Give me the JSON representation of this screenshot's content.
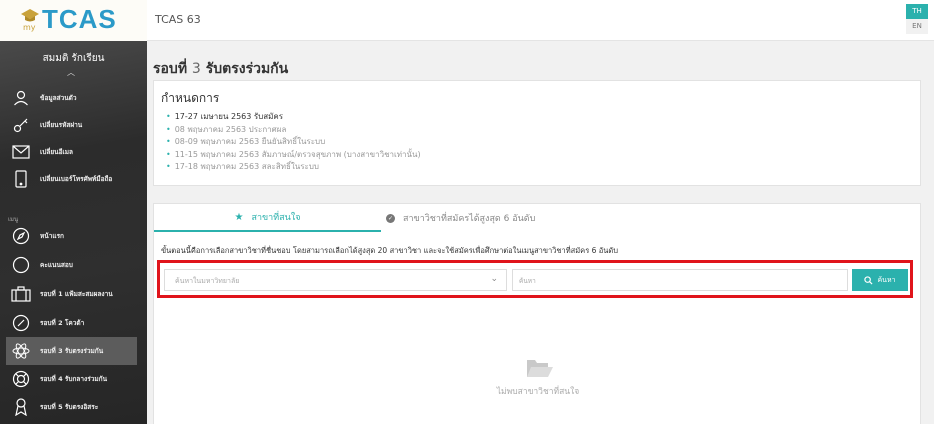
{
  "header": {
    "logo_prefix": "my",
    "logo_text": "TCAS",
    "title": "TCAS 63",
    "lang_th": "TH",
    "lang_en": "EN"
  },
  "sidebar": {
    "user_name": "สมมติ รักเรียน",
    "menu_heading": "เมนู",
    "account_items": [
      {
        "label": "ข้อมูลส่วนตัว",
        "icon": "user-icon"
      },
      {
        "label": "เปลี่ยนรหัสผ่าน",
        "icon": "key-icon"
      },
      {
        "label": "เปลี่ยนอีเมล",
        "icon": "mail-icon"
      },
      {
        "label": "เปลี่ยนเบอร์โทรศัพท์มือถือ",
        "icon": "phone-icon"
      }
    ],
    "menu_items": [
      {
        "label": "หน้าแรก",
        "icon": "compass-icon"
      },
      {
        "label": "คะแนนสอบ",
        "icon": "circle-icon"
      },
      {
        "label": "รอบที่ 1 แฟ้มสะสมผลงาน",
        "icon": "portfolio-icon"
      },
      {
        "label": "รอบที่ 2 โควต้า",
        "icon": "quota-icon"
      },
      {
        "label": "รอบที่ 3 รับตรงร่วมกัน",
        "icon": "atom-icon",
        "active": true
      },
      {
        "label": "รอบที่ 4 รับกลางร่วมกัน",
        "icon": "lifebuoy-icon"
      },
      {
        "label": "รอบที่ 5 รับตรงอิสระ",
        "icon": "medal-icon"
      }
    ]
  },
  "main": {
    "title_prefix": "รอบที่",
    "title_number": "3",
    "title_suffix": "รับตรงร่วมกัน",
    "schedule": {
      "heading": "กำหนดการ",
      "items": [
        "17-27 เมษายน 2563 รับสมัคร",
        "08 พฤษภาคม 2563 ประกาศผล",
        "08-09 พฤษภาคม 2563 ยืนยันสิทธิ์ในระบบ",
        "11-15 พฤษภาคม 2563 สัมภาษณ์/ตรวจสุขภาพ (บางสาขาวิชาเท่านั้น)",
        "17-18 พฤษภาคม 2563 สละสิทธิ์ในระบบ"
      ]
    },
    "tabs": {
      "interested": "สาขาที่สนใจ",
      "applied": "สาขาวิชาที่สมัครได้สูงสุด 6 อันดับ"
    },
    "instruction": "ขั้นตอนนี้คือการเลือกสาขาวิชาที่ชื่นชอบ โดยสามารถเลือกได้สูงสุด 20 สาขาวิชา และจะใช้สมัครเพื่อศึกษาต่อในเมนูสาขาวิชาที่สมัคร 6 อันดับ",
    "search": {
      "university_placeholder": "ค้นหาในมหาวิทยาลัย",
      "keyword_placeholder": "ค้นหา",
      "button_label": "ค้นหา"
    },
    "empty_text": "ไม่พบสาขาวิชาที่สนใจ"
  },
  "colors": {
    "accent": "#2bb1ad",
    "brand": "#2b9ac8",
    "highlight": "#e0141b"
  }
}
